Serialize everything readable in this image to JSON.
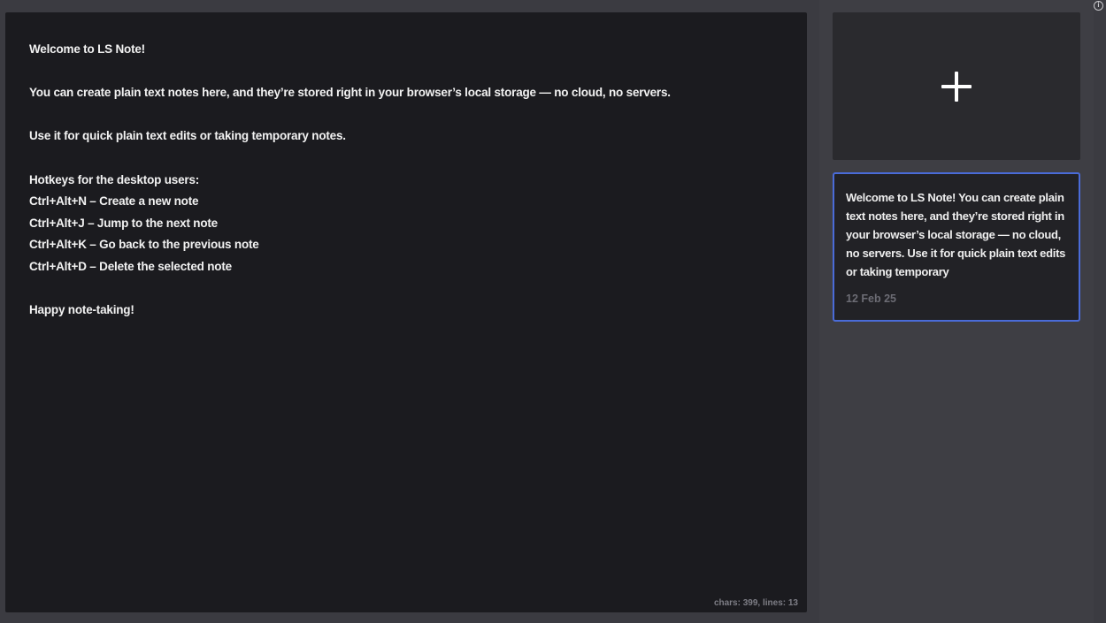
{
  "editor": {
    "lines": [
      "Welcome to LS Note!",
      "",
      "You can create plain text notes here, and they’re stored right in your browser’s local storage — no cloud, no servers.",
      "",
      "Use it for quick plain text edits or taking temporary notes.",
      "",
      "Hotkeys for the desktop users:",
      "Ctrl+Alt+N – Create a new note",
      "Ctrl+Alt+J – Jump to the next note",
      "Ctrl+Alt+K – Go back to the previous note",
      "Ctrl+Alt+D – Delete the selected note",
      "",
      "Happy note-taking!"
    ],
    "stats": "chars: 399, lines: 13"
  },
  "sidebar": {
    "new_note_icon": "plus-icon",
    "notes": [
      {
        "preview": "Welcome to LS Note! You can create plain text notes here, and they’re stored right in your browser’s local storage — no cloud, no servers. Use it for quick plain text edits or taking temporary",
        "date": "12 Feb 25",
        "selected": true
      }
    ]
  },
  "info": {
    "icon": "info-icon",
    "glyph": "i"
  },
  "colors": {
    "selected_border": "#4a6bd8",
    "editor_bg": "#1b1b1f",
    "app_bg": "#3b3b41"
  }
}
